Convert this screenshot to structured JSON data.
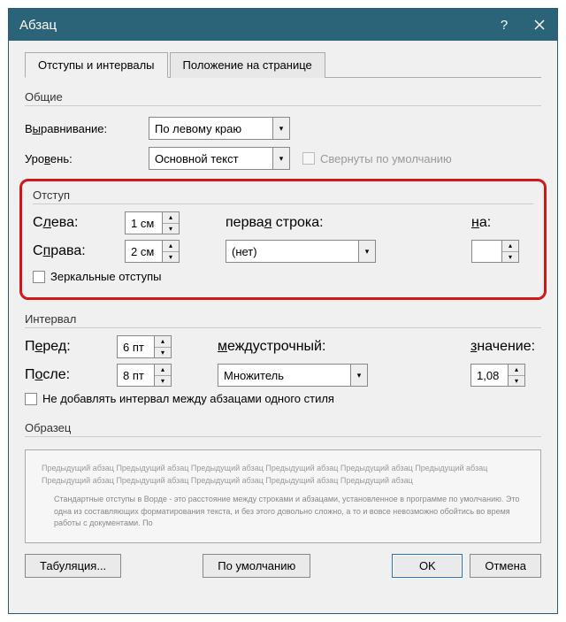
{
  "window": {
    "title": "Абзац"
  },
  "tabs": {
    "indents": "Отступы и интервалы",
    "position": "Положение на странице"
  },
  "general": {
    "label": "Общие",
    "alignment_label_pre": "В",
    "alignment_label_u": "ы",
    "alignment_label_post": "равнивание:",
    "alignment_value": "По левому краю",
    "level_label_pre": "Уро",
    "level_label_u": "в",
    "level_label_post": "ень:",
    "level_value": "Основной текст",
    "collapse_label": "Свернуты по умолчанию"
  },
  "indent": {
    "label": "Отступ",
    "left_label_pre": "С",
    "left_label_u": "л",
    "left_label_post": "ева:",
    "left_value": "1 см",
    "right_label_pre": "С",
    "right_label_u": "п",
    "right_label_post": "рава:",
    "right_value": "2 см",
    "first_label_pre": "перва",
    "first_label_u": "я",
    "first_label_post": " строка:",
    "first_value": "(нет)",
    "by_label_u": "н",
    "by_label_post": "а:",
    "by_value": "",
    "mirror_label": "Зеркальные отступы"
  },
  "interval": {
    "label": "Интервал",
    "before_label_pre": "П",
    "before_label_u": "е",
    "before_label_post": "ред:",
    "before_value": "6 пт",
    "after_label_pre": "П",
    "after_label_u": "о",
    "after_label_post": "сле:",
    "after_value": "8 пт",
    "line_label_u": "м",
    "line_label_post": "еждустрочный:",
    "line_value": "Множитель",
    "val_label_u": "з",
    "val_label_post": "начение:",
    "val_value": "1,08",
    "nospace_label": "Не добавлять интервал между абзацами одного стиля"
  },
  "preview": {
    "label": "Образец",
    "line1": "Предыдущий абзац Предыдущий абзац Предыдущий абзац Предыдущий абзац Предыдущий абзац Предыдущий абзац Предыдущий абзац Предыдущий абзац Предыдущий абзац Предыдущий абзац Предыдущий абзац",
    "line2": "Стандартные отступы в Ворде - это расстояние между строками и абзацами, установленное в программе по умолчанию. Это одна из составляющих форматирования текста, и без этого довольно сложно, а то и вовсе невозможно обойтись во время работы с документами. По"
  },
  "buttons": {
    "tabs": "Табуляция...",
    "default": "По умолчанию",
    "ok": "OK",
    "cancel": "Отмена"
  }
}
